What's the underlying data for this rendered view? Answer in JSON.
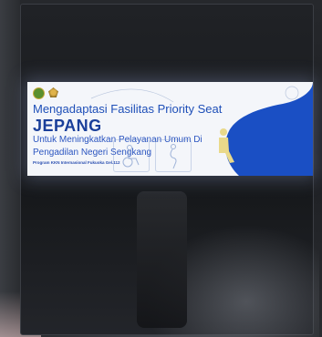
{
  "banner": {
    "line1": "Mengadaptasi Fasilitas Priority Seat",
    "line2": "JEPANG",
    "line3": "Untuk Meningkatkan Pelayanan Umum Di",
    "line4": "Pengadilan Negeri Sengkang",
    "program": "Program KKN Internasional Fukuoka Gel.112"
  },
  "colors": {
    "accent_blue": "#1a4fc4",
    "banner_bg": "#f4f6fa",
    "surroundings": "#1c1e22"
  },
  "icons": [
    "logo-emblem-icon",
    "logo-crest-icon",
    "wheelchair-icon",
    "pregnant-woman-icon",
    "seated-person-icon"
  ]
}
